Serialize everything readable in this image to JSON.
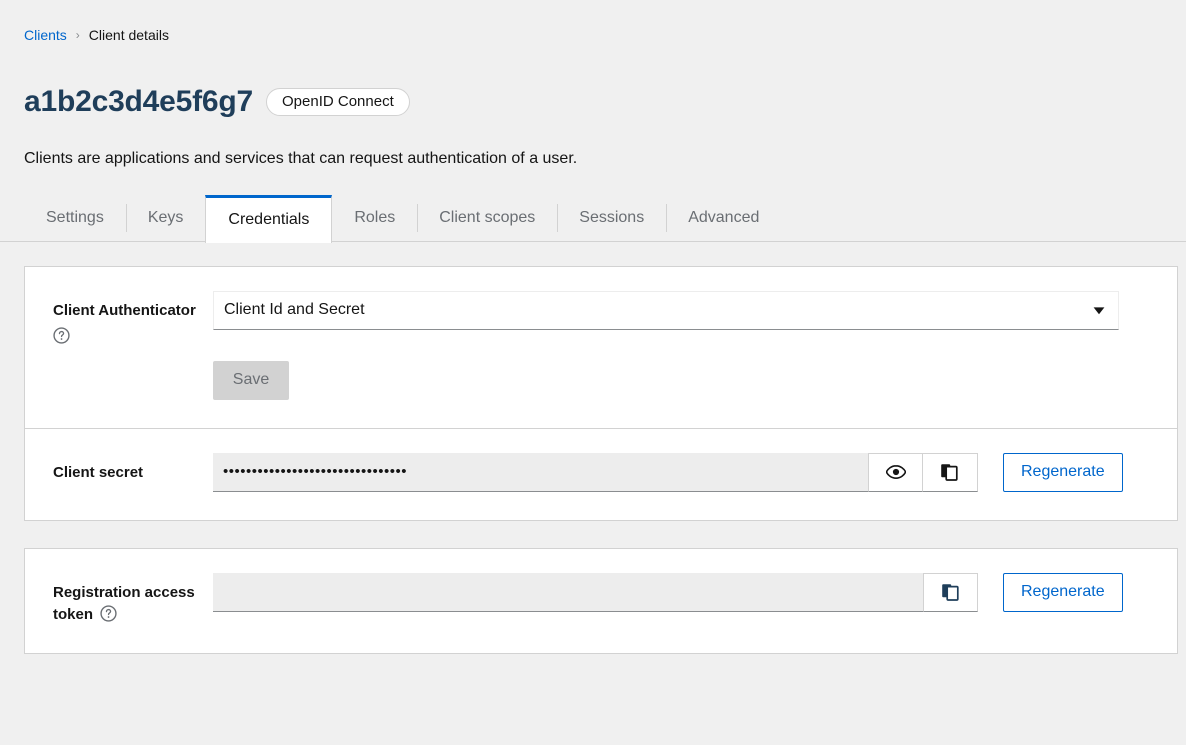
{
  "breadcrumb": {
    "parent": "Clients",
    "separator": "›",
    "current": "Client details"
  },
  "header": {
    "title": "a1b2c3d4e5f6g7",
    "badge": "OpenID Connect",
    "subtitle": "Clients are applications and services that can request authentication of a user."
  },
  "tabs": [
    {
      "label": "Settings",
      "active": false
    },
    {
      "label": "Keys",
      "active": false
    },
    {
      "label": "Credentials",
      "active": true
    },
    {
      "label": "Roles",
      "active": false
    },
    {
      "label": "Client scopes",
      "active": false
    },
    {
      "label": "Sessions",
      "active": false
    },
    {
      "label": "Advanced",
      "active": false
    }
  ],
  "authenticator": {
    "label": "Client Authenticator",
    "help_icon": "help-circle-icon",
    "selected": "Client Id and Secret",
    "caret_icon": "caret-down-icon",
    "save_label": "Save",
    "save_disabled": true
  },
  "client_secret": {
    "label": "Client secret",
    "value": "••••••••••••••••••••••••••••••••",
    "show_icon": "eye-icon",
    "copy_icon": "copy-icon",
    "regenerate_label": "Regenerate"
  },
  "registration_token": {
    "label": "Registration access token",
    "help_icon": "help-circle-icon",
    "value": "",
    "copy_icon": "copy-icon",
    "regenerate_label": "Regenerate"
  },
  "colors": {
    "accent": "#0066cc",
    "title": "#1f3e5a",
    "page_bg": "#f0f0f0",
    "border": "#d2d2d2",
    "muted_text": "#6a6e73",
    "input_bg": "#ededed"
  }
}
